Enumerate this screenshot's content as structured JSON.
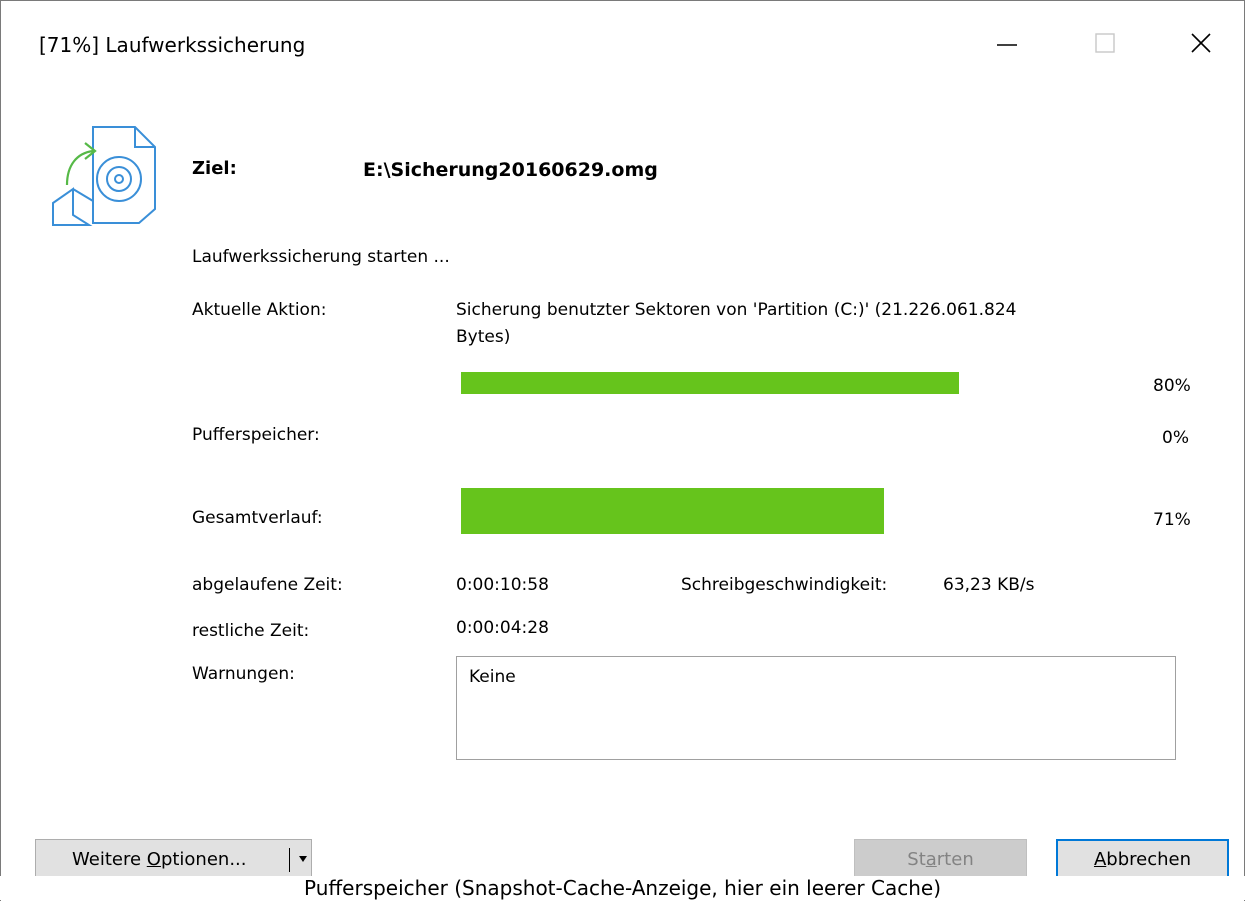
{
  "window": {
    "title": "[71%] Laufwerkssicherung",
    "min_icon": "minimize-icon",
    "max_icon": "maximize-icon",
    "close_icon": "close-icon"
  },
  "target": {
    "label": "Ziel:",
    "value": "E:\\Sicherung20160629.omg"
  },
  "status": "Laufwerkssicherung starten ...",
  "current_action": {
    "label": "Aktuelle Aktion:",
    "value_line1": "Sicherung benutzter Sektoren von 'Partition (C:)' (21.226.061.824",
    "value_line2": "Bytes)",
    "progress_percent": 80,
    "progress_text": "80%"
  },
  "buffer": {
    "label": "Pufferspeicher:",
    "progress_percent": 0,
    "progress_text": "0%"
  },
  "overall": {
    "label": "Gesamtverlauf:",
    "progress_percent": 71,
    "progress_text": "71%"
  },
  "timing": {
    "elapsed_label": "abgelaufene Zeit:",
    "elapsed_value": "0:00:10:58",
    "remaining_label": "restliche Zeit:",
    "remaining_value": "0:00:04:28",
    "speed_label": "Schreibgeschwindigkeit:",
    "speed_value": "63,23 KB/s"
  },
  "warnings": {
    "label": "Warnungen:",
    "value": "Keine"
  },
  "buttons": {
    "more_options_pre": "Weitere ",
    "more_options_u": "O",
    "more_options_post": "ptionen...",
    "start_pre": "St",
    "start_u": "a",
    "start_post": "rten",
    "cancel_u": "A",
    "cancel_post": "bbrechen"
  },
  "colors": {
    "progress": "#66c41c",
    "focus": "#0078d7",
    "icon_blue": "#3a8fd8",
    "icon_green": "#56b947"
  },
  "caption": "Pufferspeicher (Snapshot-Cache-Anzeige, hier ein leerer Cache)"
}
